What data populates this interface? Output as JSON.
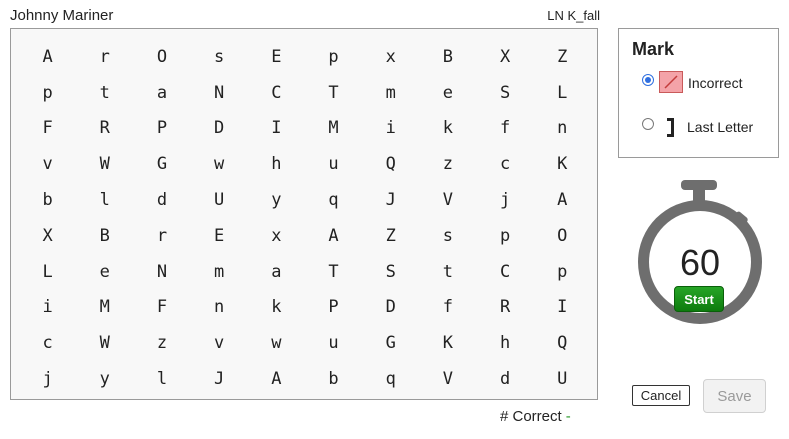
{
  "header": {
    "student_name": "Johnny Mariner",
    "probe": "LN K_fall"
  },
  "grid": {
    "rows": [
      [
        "A",
        "r",
        "O",
        "s",
        "E",
        "p",
        "x",
        "B",
        "X",
        "Z"
      ],
      [
        "p",
        "t",
        "a",
        "N",
        "C",
        "T",
        "m",
        "e",
        "S",
        "L"
      ],
      [
        "F",
        "R",
        "P",
        "D",
        "I",
        "M",
        "i",
        "k",
        "f",
        "n"
      ],
      [
        "v",
        "W",
        "G",
        "w",
        "h",
        "u",
        "Q",
        "z",
        "c",
        "K"
      ],
      [
        "b",
        "l",
        "d",
        "U",
        "y",
        "q",
        "J",
        "V",
        "j",
        "A"
      ],
      [
        "X",
        "B",
        "r",
        "E",
        "x",
        "A",
        "Z",
        "s",
        "p",
        "O"
      ],
      [
        "L",
        "e",
        "N",
        "m",
        "a",
        "T",
        "S",
        "t",
        "C",
        "p"
      ],
      [
        "i",
        "M",
        "F",
        "n",
        "k",
        "P",
        "D",
        "f",
        "R",
        "I"
      ],
      [
        "c",
        "W",
        "z",
        "v",
        "w",
        "u",
        "G",
        "K",
        "h",
        "Q"
      ],
      [
        "j",
        "y",
        "l",
        "J",
        "A",
        "b",
        "q",
        "V",
        "d",
        "U"
      ]
    ]
  },
  "mark": {
    "title": "Mark",
    "options": [
      {
        "label": "Incorrect",
        "selected": true
      },
      {
        "label": "Last Letter",
        "selected": false
      }
    ]
  },
  "timer": {
    "value": "60",
    "start_label": "Start"
  },
  "score": {
    "label": "# Correct",
    "value": "-"
  },
  "actions": {
    "cancel_label": "Cancel",
    "save_label": "Save"
  },
  "colors": {
    "accent_green": "#0d7b0d",
    "incorrect_fill": "#f4a3a8",
    "radio_blue": "#2f6fe0"
  }
}
